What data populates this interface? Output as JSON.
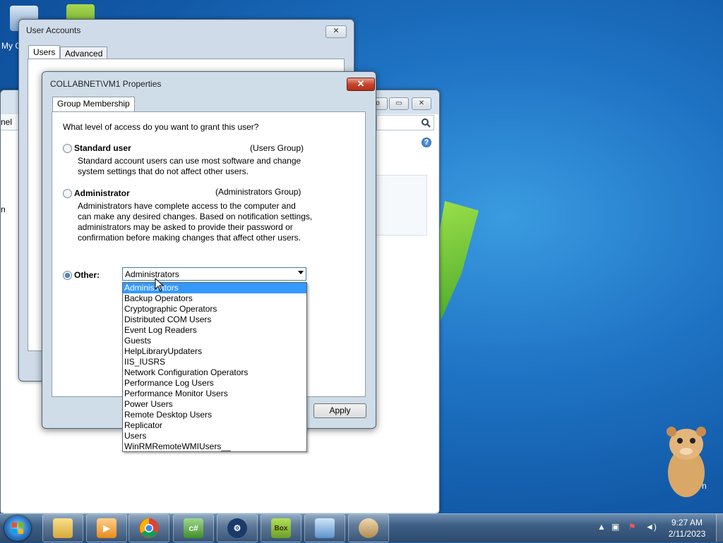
{
  "desktop": {
    "icon_partial_label": "My C",
    "hamster_partial_label": "n"
  },
  "user_accounts": {
    "title": "User Accounts",
    "close": "✕",
    "tabs": [
      {
        "label": "Users"
      },
      {
        "label": "Advanced"
      }
    ]
  },
  "control_panel": {
    "partial_label_1": "nel",
    "partial_label_2": "n",
    "buttons": {
      "back_partial": "o",
      "maximize": "▭",
      "close": "✕"
    }
  },
  "dialog": {
    "title": "COLLABNET\\VM1 Properties",
    "close": "✕",
    "tab": "Group Membership",
    "question": "What level of access do you want to grant this user?",
    "standard": {
      "label": "Standard user",
      "group": "(Users Group)",
      "desc": [
        "Standard account users can use most software and change",
        "system settings that do not affect other users."
      ]
    },
    "administrator": {
      "label": "Administrator",
      "group": "(Administrators Group)",
      "desc": [
        "Administrators have complete access to the computer and",
        "can make any desired changes. Based on notification settings,",
        "administrators may be asked to provide their password or",
        "confirmation before making changes that affect other users."
      ]
    },
    "other": {
      "label": "Other:",
      "selected": "Administrators",
      "options": [
        "Administrators",
        "Backup Operators",
        "Cryptographic Operators",
        "Distributed COM Users",
        "Event Log Readers",
        "Guests",
        "HelpLibraryUpdaters",
        "IIS_IUSRS",
        "Network Configuration Operators",
        "Performance Log Users",
        "Performance Monitor Users",
        "Power Users",
        "Remote Desktop Users",
        "Replicator",
        "Users",
        "WinRMRemoteWMIUsers__"
      ]
    },
    "apply": "Apply"
  },
  "taskbar": {
    "items": [
      {
        "name": "explorer",
        "label": ""
      },
      {
        "name": "media-player",
        "label": ""
      },
      {
        "name": "chrome",
        "label": ""
      },
      {
        "name": "csharp",
        "label": "c#"
      },
      {
        "name": "cheat-engine",
        "label": ""
      },
      {
        "name": "box",
        "label": "Box"
      },
      {
        "name": "control-panel",
        "label": ""
      },
      {
        "name": "user-accounts",
        "label": ""
      }
    ],
    "time": "9:27 AM",
    "date": "2/11/2023"
  },
  "colors": {
    "selection": "#3399ff",
    "accent": "#3c7fb1",
    "close_red": "#c8442c"
  }
}
